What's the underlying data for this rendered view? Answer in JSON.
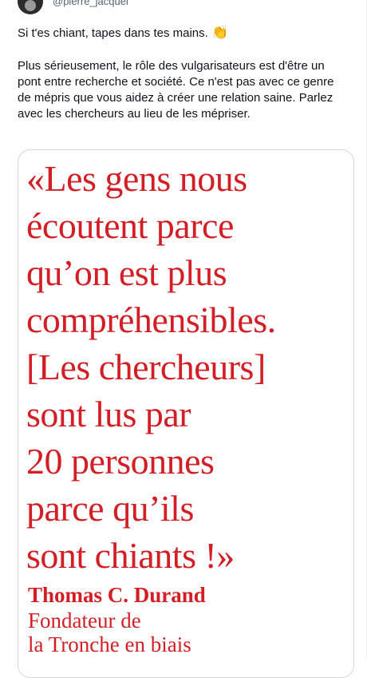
{
  "tweet": {
    "handle": "@pierre_jacquel",
    "line1": "Si t'es chiant, tapes dans tes mains.",
    "clap_emoji": "👏",
    "paragraph": "Plus sérieusement, le rôle des vulgarisateurs est d'être un pont entre recherche et société. Ce n'est pas avec ce genre de mépris que vous aidez à créer une relation saine. Parlez avec les chercheurs au lieu de les mépriser."
  },
  "media": {
    "quote_lines": [
      "«Les gens nous",
      "écoutent parce",
      "qu’on est plus",
      "compréhensibles.",
      "[Les chercheurs]",
      "sont lus par",
      "20 personnes",
      "parce qu’ils",
      "sont chiants !»"
    ],
    "author": "Thomas C. Durand",
    "role_line1": "Fondateur de",
    "role_line2": "la Tronche en biais",
    "accent_color": "#d41e26"
  }
}
